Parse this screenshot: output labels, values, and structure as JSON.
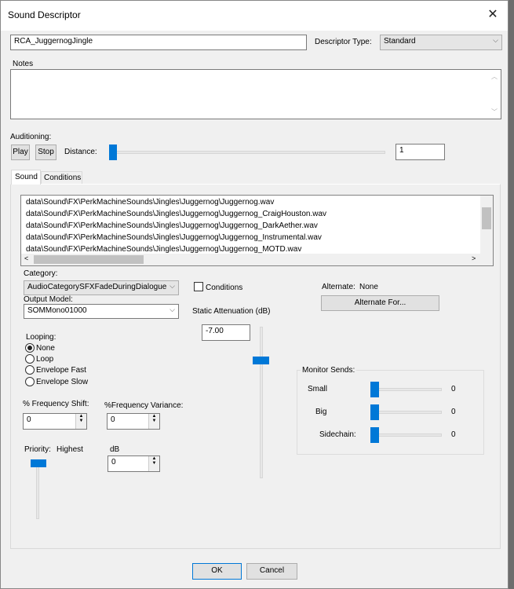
{
  "window": {
    "title": "Sound Descriptor",
    "close_icon": "close-icon"
  },
  "name_value": "RCA_JuggernogJingle",
  "descriptor_type": {
    "label": "Descriptor Type:",
    "value": "Standard"
  },
  "notes": {
    "label": "Notes",
    "value": ""
  },
  "auditioning": {
    "label": "Auditioning:",
    "play": "Play",
    "stop": "Stop",
    "distance_label": "Distance:",
    "distance_value": "1",
    "distance_slider": 0
  },
  "tabs": [
    {
      "label": "Sound",
      "active": true
    },
    {
      "label": "Conditions",
      "active": false
    }
  ],
  "files": [
    "data\\Sound\\FX\\PerkMachineSounds\\Jingles\\Juggernog\\Juggernog.wav",
    "data\\Sound\\FX\\PerkMachineSounds\\Jingles\\Juggernog\\Juggernog_CraigHouston.wav",
    "data\\Sound\\FX\\PerkMachineSounds\\Jingles\\Juggernog\\Juggernog_DarkAether.wav",
    "data\\Sound\\FX\\PerkMachineSounds\\Jingles\\Juggernog\\Juggernog_Instrumental.wav",
    "data\\Sound\\FX\\PerkMachineSounds\\Jingles\\Juggernog\\Juggernog_MOTD.wav"
  ],
  "category": {
    "label": "Category:",
    "value": "AudioCategorySFXFadeDuringDialogue"
  },
  "output_model": {
    "label": "Output Model:",
    "value": "SOMMono01000"
  },
  "conditions_checkbox": {
    "label": "Conditions",
    "checked": false
  },
  "static_attenuation": {
    "label": "Static Attenuation (dB)",
    "value": "-7.00"
  },
  "alternate": {
    "label": "Alternate:",
    "value": "None",
    "button": "Alternate For..."
  },
  "looping": {
    "label": "Looping:",
    "options": [
      "None",
      "Loop",
      "Envelope Fast",
      "Envelope Slow"
    ],
    "selected": "None"
  },
  "frequency_shift": {
    "label": "% Frequency Shift:",
    "value": "0"
  },
  "frequency_variance": {
    "label": "%Frequency Variance:",
    "value": "0"
  },
  "priority": {
    "label": "Priority:",
    "value": "Highest"
  },
  "db": {
    "label": "dB",
    "value": "0"
  },
  "monitor_sends": {
    "label": "Monitor Sends:",
    "items": [
      {
        "label": "Small",
        "value": "0"
      },
      {
        "label": "Big",
        "value": "0"
      },
      {
        "label": "Sidechain:",
        "value": "0"
      }
    ]
  },
  "footer": {
    "ok": "OK",
    "cancel": "Cancel"
  },
  "colors": {
    "accent": "#0078d7"
  }
}
